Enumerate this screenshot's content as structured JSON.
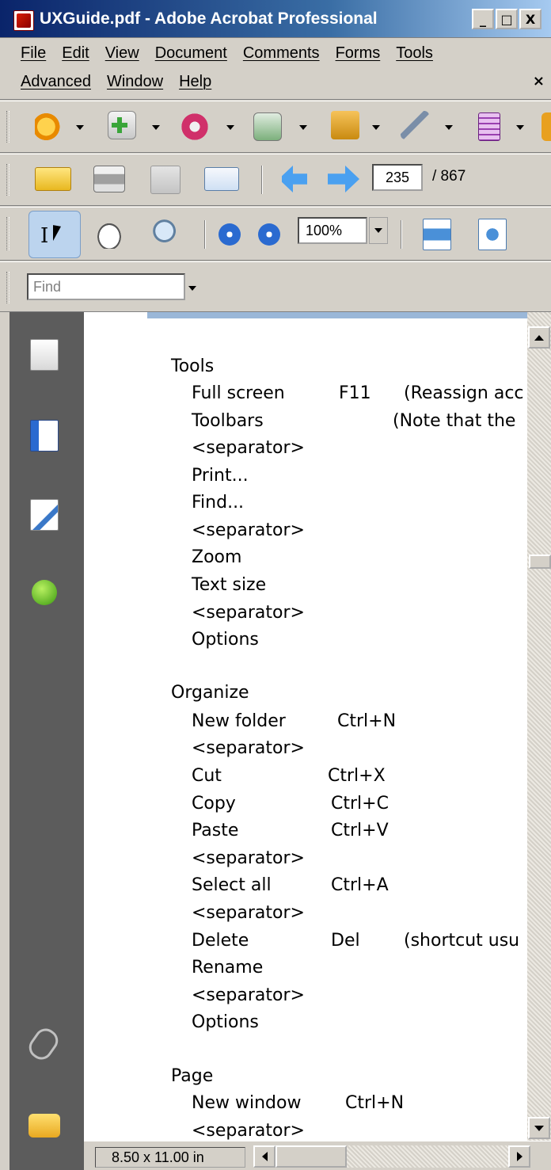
{
  "window": {
    "title": "UXGuide.pdf - Adobe Acrobat Professional",
    "min_label": "_",
    "max_label": "□",
    "close_label": "X"
  },
  "menubar": {
    "row1": [
      "File",
      "Edit",
      "View",
      "Document",
      "Comments",
      "Forms",
      "Tools"
    ],
    "row2": [
      "Advanced",
      "Window",
      "Help"
    ],
    "close_label": "×"
  },
  "navigation": {
    "current_page": "235",
    "total_pages": "/ 867"
  },
  "zoom": {
    "value": "100%"
  },
  "find": {
    "placeholder": "Find"
  },
  "status": {
    "page_size": "8.50 x 11.00 in"
  },
  "document": {
    "lines": [
      {
        "col1": "Tools"
      },
      {
        "col1": "Full screen",
        "col2": "F11",
        "col3": "(Reassign acc"
      },
      {
        "col1": "Toolbars",
        "col3": "(Note that the"
      },
      {
        "col1": "<separator>"
      },
      {
        "col1": "Print..."
      },
      {
        "col1": "Find..."
      },
      {
        "col1": "<separator>"
      },
      {
        "col1": "Zoom"
      },
      {
        "col1": "Text size"
      },
      {
        "col1": "<separator>"
      },
      {
        "col1": "Options"
      },
      {
        "col1": "Organize"
      },
      {
        "col1": "New folder",
        "col2": "Ctrl+N"
      },
      {
        "col1": "<separator>"
      },
      {
        "col1": "Cut",
        "col2": "Ctrl+X"
      },
      {
        "col1": "Copy",
        "col2": "Ctrl+C"
      },
      {
        "col1": "Paste",
        "col2": "Ctrl+V"
      },
      {
        "col1": "<separator>"
      },
      {
        "col1": "Select all",
        "col2": "Ctrl+A"
      },
      {
        "col1": "<separator>"
      },
      {
        "col1": "Delete",
        "col2": "Del",
        "col3": "(shortcut usu"
      },
      {
        "col1": "Rename"
      },
      {
        "col1": "<separator>"
      },
      {
        "col1": "Options"
      },
      {
        "col1": "Page"
      },
      {
        "col1": "New window",
        "col2": "Ctrl+N"
      },
      {
        "col1": "<separator>"
      }
    ]
  },
  "icons": {
    "toolbar1": [
      "create-pdf-icon",
      "combine-files-icon",
      "export-icon",
      "review-icon",
      "secure-lock-icon",
      "sign-pen-icon",
      "forms-icon"
    ],
    "toolbar2": [
      "open-folder-icon",
      "print-icon",
      "save-icon",
      "email-icon",
      "previous-page-icon",
      "next-page-icon"
    ],
    "toolbar3": [
      "select-tool-icon",
      "hand-tool-icon",
      "zoom-tool-icon",
      "zoom-out-icon",
      "zoom-in-icon",
      "fit-width-icon",
      "fit-page-icon"
    ],
    "sidebar": [
      "pages-icon",
      "bookmarks-icon",
      "signatures-icon",
      "help-icon",
      "attachments-icon",
      "comments-icon"
    ]
  }
}
